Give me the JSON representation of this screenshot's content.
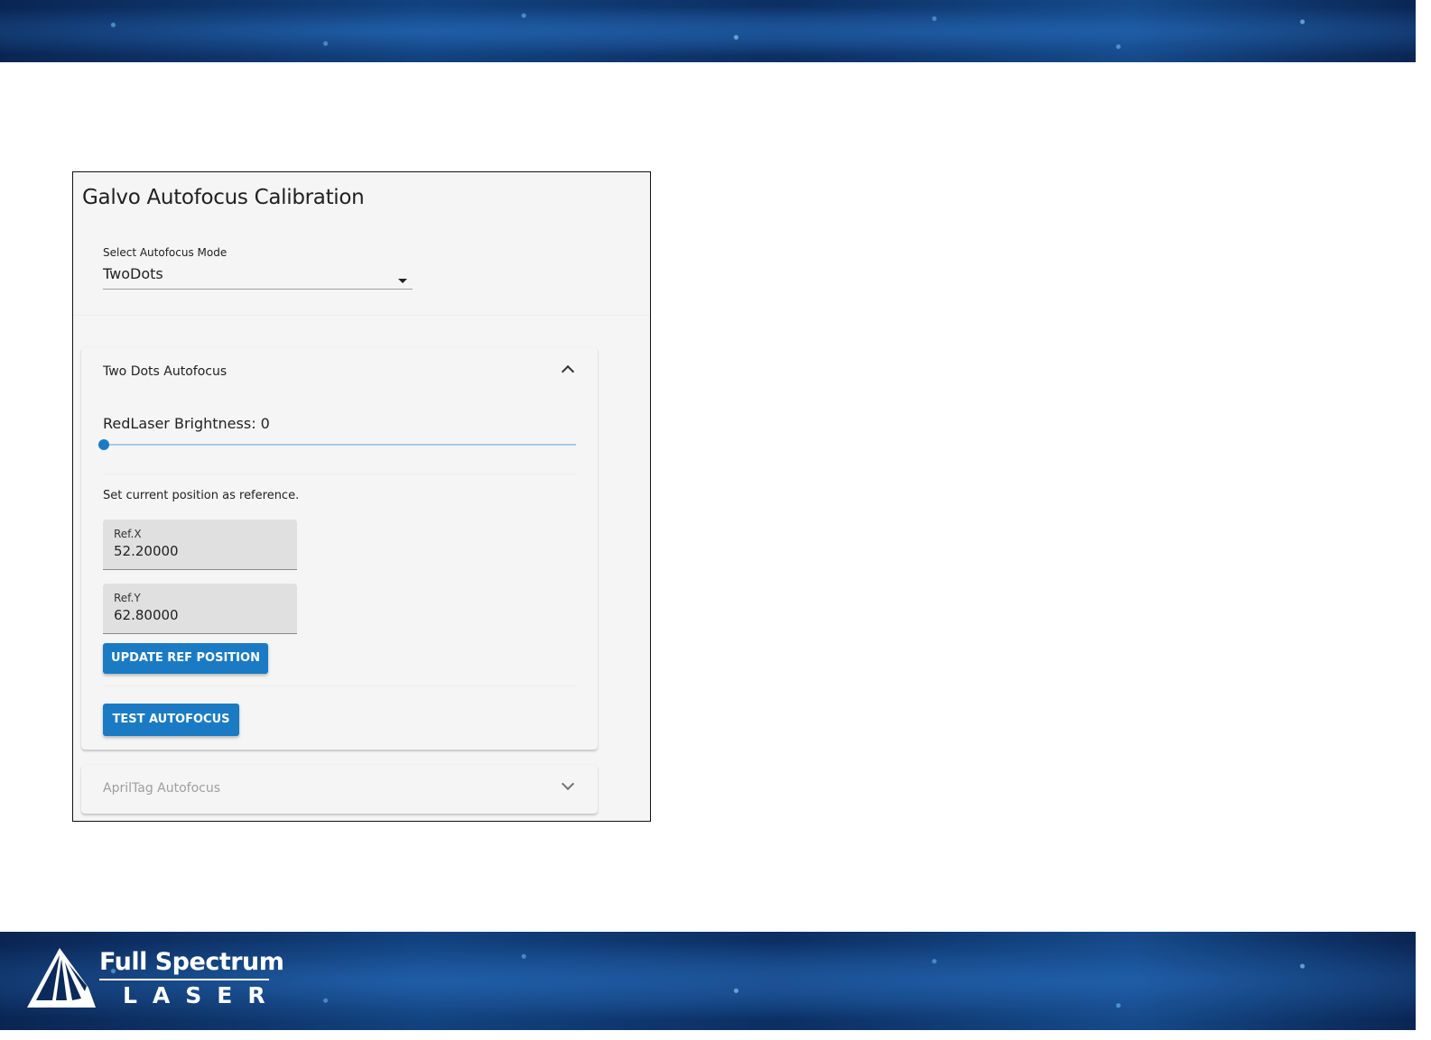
{
  "brand": {
    "name_top": "Full Spectrum",
    "name_bottom": "LASER",
    "logo_icon": "full-spectrum-logo-icon",
    "banner_color": "#0b2a5a"
  },
  "panel": {
    "title": "Galvo Autofocus Calibration",
    "select": {
      "label": "Select Autofocus Mode",
      "value": "TwoDots"
    },
    "two_dots": {
      "header": "Two Dots Autofocus",
      "expanded_icon": "chevron-up-icon",
      "brightness_label": "RedLaser Brightness: 0",
      "brightness_value": 0,
      "hint": "Set current position as reference.",
      "ref_x": {
        "label": "Ref.X",
        "value": "52.20000"
      },
      "ref_y": {
        "label": "Ref.Y",
        "value": "62.80000"
      },
      "update_button": "Update Ref Position",
      "test_button": "Test Autofocus"
    },
    "april_tag": {
      "header": "AprilTag Autofocus",
      "collapsed_icon": "chevron-down-icon"
    }
  },
  "colors": {
    "accent": "#1a7bc4",
    "panel_bg": "#f5f5f5",
    "field_bg": "#e0e0e0"
  }
}
